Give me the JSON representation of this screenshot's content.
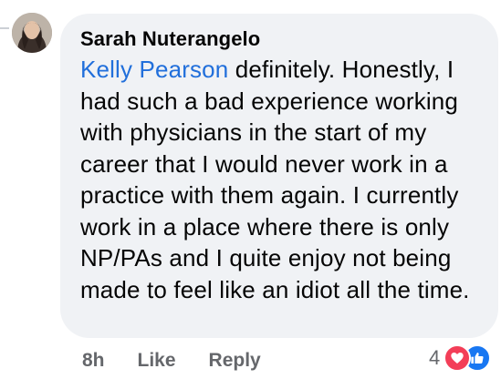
{
  "comment": {
    "author": "Sarah Nuterangelo",
    "mention": "Kelly Pearson",
    "text_after_mention": " definitely. Honestly, I had such a bad experience working with physicians in the start of my career that I would never work in a practice with them again. I currently work in a place where there is only NP/PAs and I quite enjoy not being made to feel like an idiot all the time."
  },
  "actions": {
    "timestamp": "8h",
    "like_label": "Like",
    "reply_label": "Reply"
  },
  "reactions": {
    "count": "4",
    "types": [
      "love-icon",
      "like-icon"
    ],
    "colors": {
      "love": "#f33e58",
      "like": "#1877f2"
    }
  },
  "colors": {
    "bubble_bg": "#f0f2f5",
    "mention": "#216fdb",
    "secondary_text": "#65676b"
  }
}
